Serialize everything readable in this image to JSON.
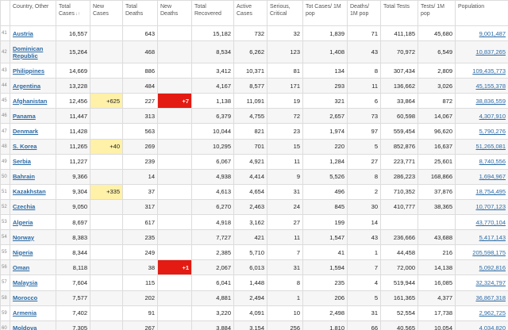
{
  "headers": {
    "idx": "",
    "country": "Country, Other",
    "total_cases": "Total Cases",
    "new_cases": "New Cases",
    "total_deaths": "Total Deaths",
    "new_deaths": "New Deaths",
    "total_recovered": "Total Recovered",
    "active_cases": "Active Cases",
    "serious": "Serious, Critical",
    "cases_1m": "Tot Cases/ 1M pop",
    "deaths_1m": "Deaths/ 1M pop",
    "total_tests": "Total Tests",
    "tests_1m": "Tests/ 1M pop",
    "population": "Population"
  },
  "rows": [
    {
      "idx": "41",
      "country": "Austria",
      "total_cases": "16,557",
      "new_cases": "",
      "total_deaths": "643",
      "new_deaths": "",
      "total_recovered": "15,182",
      "active_cases": "732",
      "serious": "32",
      "cases_1m": "1,839",
      "deaths_1m": "71",
      "total_tests": "411,185",
      "tests_1m": "45,680",
      "population": "9,001,487"
    },
    {
      "idx": "42",
      "country": "Dominican Republic",
      "total_cases": "15,264",
      "new_cases": "",
      "total_deaths": "468",
      "new_deaths": "",
      "total_recovered": "8,534",
      "active_cases": "6,262",
      "serious": "123",
      "cases_1m": "1,408",
      "deaths_1m": "43",
      "total_tests": "70,972",
      "tests_1m": "6,549",
      "population": "10,837,265"
    },
    {
      "idx": "43",
      "country": "Philippines",
      "total_cases": "14,669",
      "new_cases": "",
      "total_deaths": "886",
      "new_deaths": "",
      "total_recovered": "3,412",
      "active_cases": "10,371",
      "serious": "81",
      "cases_1m": "134",
      "deaths_1m": "8",
      "total_tests": "307,434",
      "tests_1m": "2,809",
      "population": "109,435,773"
    },
    {
      "idx": "44",
      "country": "Argentina",
      "total_cases": "13,228",
      "new_cases": "",
      "total_deaths": "484",
      "new_deaths": "",
      "total_recovered": "4,167",
      "active_cases": "8,577",
      "serious": "171",
      "cases_1m": "293",
      "deaths_1m": "11",
      "total_tests": "136,662",
      "tests_1m": "3,026",
      "population": "45,155,378"
    },
    {
      "idx": "45",
      "country": "Afghanistan",
      "total_cases": "12,456",
      "new_cases": "+625",
      "total_deaths": "227",
      "new_deaths": "+7",
      "total_recovered": "1,138",
      "active_cases": "11,091",
      "serious": "19",
      "cases_1m": "321",
      "deaths_1m": "6",
      "total_tests": "33,864",
      "tests_1m": "872",
      "population": "38,836,559"
    },
    {
      "idx": "46",
      "country": "Panama",
      "total_cases": "11,447",
      "new_cases": "",
      "total_deaths": "313",
      "new_deaths": "",
      "total_recovered": "6,379",
      "active_cases": "4,755",
      "serious": "72",
      "cases_1m": "2,657",
      "deaths_1m": "73",
      "total_tests": "60,598",
      "tests_1m": "14,067",
      "population": "4,307,910"
    },
    {
      "idx": "47",
      "country": "Denmark",
      "total_cases": "11,428",
      "new_cases": "",
      "total_deaths": "563",
      "new_deaths": "",
      "total_recovered": "10,044",
      "active_cases": "821",
      "serious": "23",
      "cases_1m": "1,974",
      "deaths_1m": "97",
      "total_tests": "559,454",
      "tests_1m": "96,620",
      "population": "5,790,276"
    },
    {
      "idx": "48",
      "country": "S. Korea",
      "total_cases": "11,265",
      "new_cases": "+40",
      "total_deaths": "269",
      "new_deaths": "",
      "total_recovered": "10,295",
      "active_cases": "701",
      "serious": "15",
      "cases_1m": "220",
      "deaths_1m": "5",
      "total_tests": "852,876",
      "tests_1m": "16,637",
      "population": "51,265,081"
    },
    {
      "idx": "49",
      "country": "Serbia",
      "total_cases": "11,227",
      "new_cases": "",
      "total_deaths": "239",
      "new_deaths": "",
      "total_recovered": "6,067",
      "active_cases": "4,921",
      "serious": "11",
      "cases_1m": "1,284",
      "deaths_1m": "27",
      "total_tests": "223,771",
      "tests_1m": "25,601",
      "population": "8,740,556"
    },
    {
      "idx": "50",
      "country": "Bahrain",
      "total_cases": "9,366",
      "new_cases": "",
      "total_deaths": "14",
      "new_deaths": "",
      "total_recovered": "4,938",
      "active_cases": "4,414",
      "serious": "9",
      "cases_1m": "5,526",
      "deaths_1m": "8",
      "total_tests": "286,223",
      "tests_1m": "168,866",
      "population": "1,694,967"
    },
    {
      "idx": "51",
      "country": "Kazakhstan",
      "total_cases": "9,304",
      "new_cases": "+335",
      "total_deaths": "37",
      "new_deaths": "",
      "total_recovered": "4,613",
      "active_cases": "4,654",
      "serious": "31",
      "cases_1m": "496",
      "deaths_1m": "2",
      "total_tests": "710,352",
      "tests_1m": "37,876",
      "population": "18,754,495"
    },
    {
      "idx": "52",
      "country": "Czechia",
      "total_cases": "9,050",
      "new_cases": "",
      "total_deaths": "317",
      "new_deaths": "",
      "total_recovered": "6,270",
      "active_cases": "2,463",
      "serious": "24",
      "cases_1m": "845",
      "deaths_1m": "30",
      "total_tests": "410,777",
      "tests_1m": "38,365",
      "population": "10,707,123"
    },
    {
      "idx": "53",
      "country": "Algeria",
      "total_cases": "8,697",
      "new_cases": "",
      "total_deaths": "617",
      "new_deaths": "",
      "total_recovered": "4,918",
      "active_cases": "3,162",
      "serious": "27",
      "cases_1m": "199",
      "deaths_1m": "14",
      "total_tests": "",
      "tests_1m": "",
      "population": "43,770,104"
    },
    {
      "idx": "54",
      "country": "Norway",
      "total_cases": "8,383",
      "new_cases": "",
      "total_deaths": "235",
      "new_deaths": "",
      "total_recovered": "7,727",
      "active_cases": "421",
      "serious": "11",
      "cases_1m": "1,547",
      "deaths_1m": "43",
      "total_tests": "236,666",
      "tests_1m": "43,688",
      "population": "5,417,143"
    },
    {
      "idx": "55",
      "country": "Nigeria",
      "total_cases": "8,344",
      "new_cases": "",
      "total_deaths": "249",
      "new_deaths": "",
      "total_recovered": "2,385",
      "active_cases": "5,710",
      "serious": "7",
      "cases_1m": "41",
      "deaths_1m": "1",
      "total_tests": "44,458",
      "tests_1m": "216",
      "population": "205,598,175"
    },
    {
      "idx": "56",
      "country": "Oman",
      "total_cases": "8,118",
      "new_cases": "",
      "total_deaths": "38",
      "new_deaths": "+1",
      "total_recovered": "2,067",
      "active_cases": "6,013",
      "serious": "31",
      "cases_1m": "1,594",
      "deaths_1m": "7",
      "total_tests": "72,000",
      "tests_1m": "14,138",
      "population": "5,092,816"
    },
    {
      "idx": "57",
      "country": "Malaysia",
      "total_cases": "7,604",
      "new_cases": "",
      "total_deaths": "115",
      "new_deaths": "",
      "total_recovered": "6,041",
      "active_cases": "1,448",
      "serious": "8",
      "cases_1m": "235",
      "deaths_1m": "4",
      "total_tests": "519,944",
      "tests_1m": "16,085",
      "population": "32,324,797"
    },
    {
      "idx": "58",
      "country": "Morocco",
      "total_cases": "7,577",
      "new_cases": "",
      "total_deaths": "202",
      "new_deaths": "",
      "total_recovered": "4,881",
      "active_cases": "2,494",
      "serious": "1",
      "cases_1m": "206",
      "deaths_1m": "5",
      "total_tests": "161,365",
      "tests_1m": "4,377",
      "population": "36,867,318"
    },
    {
      "idx": "59",
      "country": "Armenia",
      "total_cases": "7,402",
      "new_cases": "",
      "total_deaths": "91",
      "new_deaths": "",
      "total_recovered": "3,220",
      "active_cases": "4,091",
      "serious": "10",
      "cases_1m": "2,498",
      "deaths_1m": "31",
      "total_tests": "52,554",
      "tests_1m": "17,738",
      "population": "2,962,725"
    },
    {
      "idx": "60",
      "country": "Moldova",
      "total_cases": "7,305",
      "new_cases": "",
      "total_deaths": "267",
      "new_deaths": "",
      "total_recovered": "3,884",
      "active_cases": "3,154",
      "serious": "256",
      "cases_1m": "1,810",
      "deaths_1m": "66",
      "total_tests": "40,565",
      "tests_1m": "10,054",
      "population": "4,034,820"
    }
  ]
}
